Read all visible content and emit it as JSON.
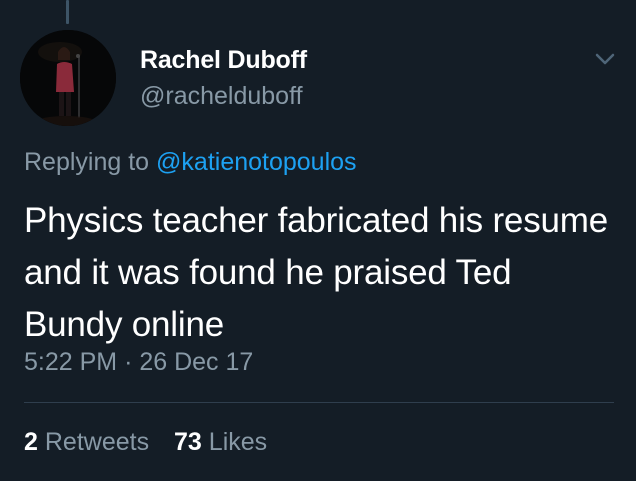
{
  "tweet": {
    "author": {
      "display_name": "Rachel Duboff",
      "handle": "@rachelduboff",
      "avatar_icon": "avatar-photo"
    },
    "replying_to": {
      "prefix": "Replying to",
      "mention": "@katienotopoulos"
    },
    "text": "Physics teacher fabricated his resume and it was found he praised Ted Bundy online",
    "time": "5:22 PM",
    "separator": "·",
    "date": "26 Dec 17",
    "stats": {
      "retweets_count": "2",
      "retweets_label": "Retweets",
      "likes_count": "73",
      "likes_label": "Likes"
    },
    "menu_icon": "chevron-down-icon"
  },
  "colors": {
    "background": "#141d26",
    "primary_text": "#ffffff",
    "secondary_text": "#8899a6",
    "link": "#1da1f2",
    "divider": "#2f3e4d"
  }
}
